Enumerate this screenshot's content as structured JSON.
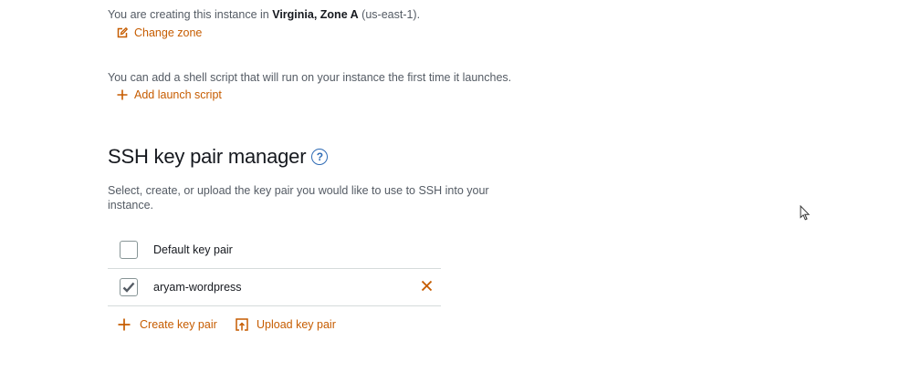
{
  "location": {
    "prefix": "You are creating this instance in ",
    "zone": "Virginia, Zone A",
    "suffix": " (us-east-1).",
    "change_zone_label": "Change zone"
  },
  "launch_script": {
    "description": "You can add a shell script that will run on your instance the first time it launches.",
    "add_label": "Add launch script"
  },
  "ssh": {
    "title": "SSH key pair manager",
    "help_glyph": "?",
    "description_line1": "Select, create, or upload the key pair you would like to use to SSH into your",
    "description_line2": "instance.",
    "key_pairs": [
      {
        "label": "Default key pair",
        "checked": false
      },
      {
        "label": "aryam-wordpress",
        "checked": true
      }
    ],
    "create_label": "Create key pair",
    "upload_label": "Upload key pair"
  },
  "colors": {
    "accent": "#c65c00",
    "help": "#2e6bb5",
    "heading": "#16191f",
    "body_text": "#545b64"
  },
  "icons": [
    "edit-icon",
    "plus-icon",
    "help-icon",
    "checkbox-unchecked",
    "checkmark-icon",
    "remove-x-icon",
    "upload-icon",
    "mouse-cursor-icon"
  ]
}
